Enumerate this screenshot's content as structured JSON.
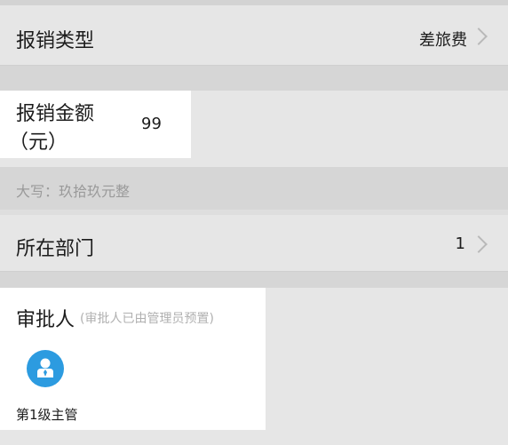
{
  "form": {
    "reimburse_type": {
      "label": "报销类型",
      "value": "差旅费"
    },
    "amount": {
      "label_line1": "报销金额",
      "label_line2": "（元）",
      "value": "99"
    },
    "amount_capital": {
      "prefix": "大写：",
      "value": "玖拾玖元整"
    },
    "department": {
      "label": "所在部门",
      "value": "1"
    },
    "approver": {
      "label": "审批人",
      "note": "(审批人已由管理员预置)",
      "person": {
        "name": "第1级主管",
        "icon": "user-avatar-icon"
      }
    }
  },
  "colors": {
    "avatar": "#2c9be0",
    "chevron": "#b9b9b9",
    "hint": "#9a9a9a"
  }
}
